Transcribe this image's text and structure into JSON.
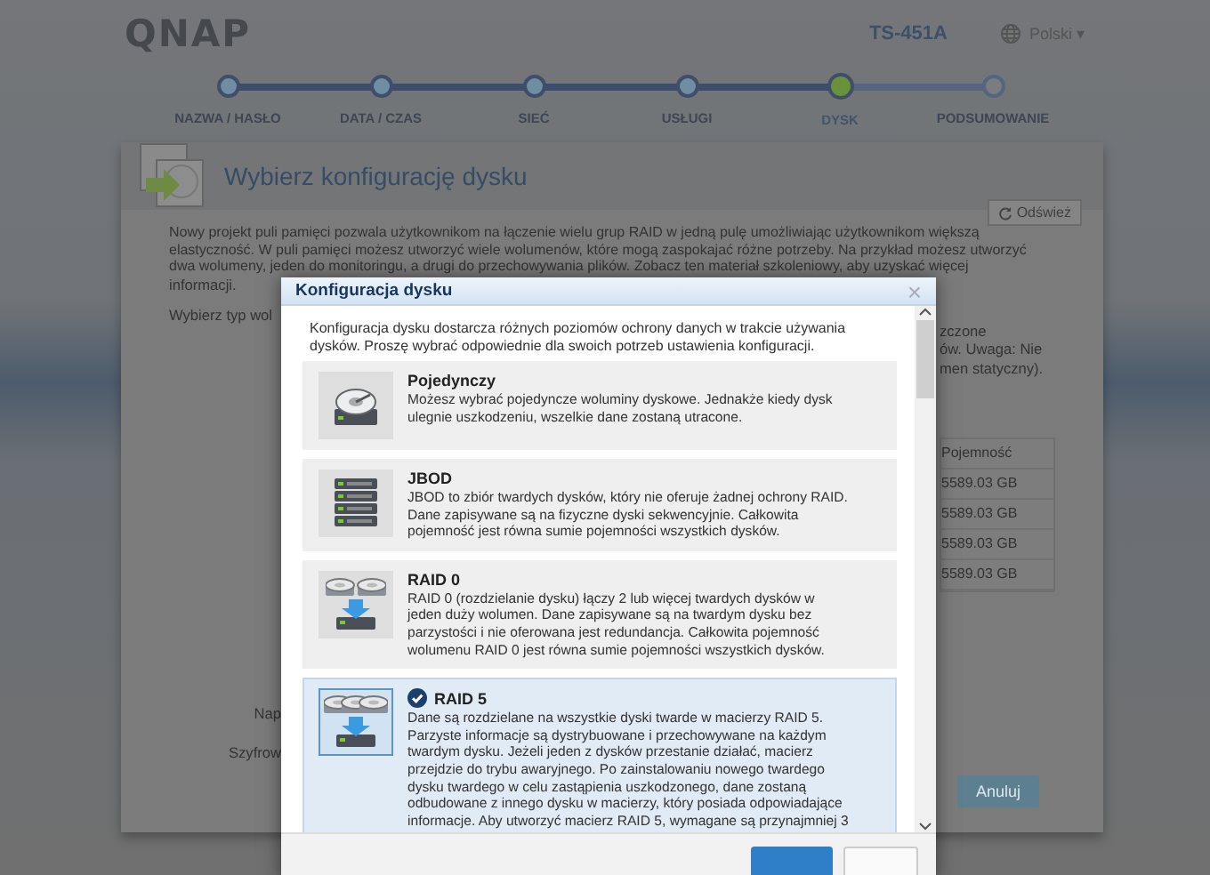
{
  "header": {
    "logo": "QNAP",
    "model": "TS-451A",
    "language": "Polski",
    "language_caret": "▾"
  },
  "steps": [
    {
      "label": "NAZWA / HASŁO",
      "completed": true,
      "selected": false
    },
    {
      "label": "DATA / CZAS",
      "completed": true,
      "selected": false
    },
    {
      "label": "SIEĆ",
      "completed": true,
      "selected": false
    },
    {
      "label": "USŁUGI",
      "completed": true,
      "selected": false
    },
    {
      "label": "DYSK",
      "completed": false,
      "selected": true
    },
    {
      "label": "PODSUMOWANIE",
      "completed": false,
      "selected": false
    }
  ],
  "page": {
    "title": "Wybierz konfigurację dysku",
    "refresh_button": "Odśwież",
    "intro_lines": [
      "Nowy projekt puli pamięci pozwala użytkownikom na łączenie wielu grup RAID w jedną pulę umożliwiając użytkownikom większą",
      "elastyczność. W puli pamięci możesz utworzyć wiele wolumenów, które mogą zaspokajać różne potrzeby. Na przykład możesz utworzyć",
      "dwa wolumeny, jeden do monitoringu, a drugi do przechowywania plików. Zobacz ten materiał szkoleniowy, aby uzyskać więcej"
    ],
    "intro_tail": "informacji.",
    "left_fragment": "Wybierz typ wol",
    "right_fragments": [
      "zczone",
      "ów. Uwaga: Nie",
      "men statyczny)."
    ],
    "table": {
      "column": "Pojemność",
      "rows": [
        "5589.03 GB",
        "5589.03 GB",
        "5589.03 GB",
        "5589.03 GB"
      ]
    },
    "form_labels": [
      "Nap",
      "Szyfrow"
    ],
    "cancel_button": "Anuluj"
  },
  "dialog": {
    "title": "Konfiguracja dysku",
    "close": "×",
    "intro_lines": [
      "Konfiguracja dysku dostarcza różnych poziomów ochrony danych w trakcie używania",
      "dysków. Proszę wybrać odpowiednie dla swoich potrzeb ustawienia konfiguracji."
    ],
    "options": [
      {
        "kind": "single",
        "name": "Pojedynczy",
        "selected": false,
        "lines": [
          "Możesz wybrać pojedyncze woluminy dyskowe. Jednakże kiedy dysk",
          "ulegnie uszkodzeniu, wszelkie dane zostaną utracone."
        ]
      },
      {
        "kind": "jbod",
        "name": "JBOD",
        "selected": false,
        "lines": [
          "JBOD to zbiór twardych dysków, który nie oferuje żadnej ochrony RAID.",
          "Dane zapisywane są na fizyczne dyski sekwencyjnie. Całkowita",
          "pojemność jest równa sumie pojemności wszystkich dysków."
        ]
      },
      {
        "kind": "raid0",
        "name": "RAID 0",
        "selected": false,
        "lines": [
          "RAID 0 (rozdzielanie dysku) łączy 2 lub więcej twardych dysków w",
          "jeden duży wolumen. Dane zapisywane są na twardym dysku bez",
          "parzystości i nie oferowana jest redundancja. Całkowita pojemność",
          "wolumenu RAID 0 jest równa sumie pojemności wszystkich dysków."
        ]
      },
      {
        "kind": "raid5",
        "name": "RAID 5",
        "selected": true,
        "lines": [
          "Dane są rozdzielane na wszystkie dyski twarde w macierzy RAID 5.",
          "Parzyste informacje są dystrybuowane i przechowywane na każdym",
          "twardym dysku. Jeżeli jeden z dysków przestanie działać, macierz",
          "przejdzie do trybu awaryjnego. Po zainstalowaniu nowego twardego",
          "dysku twardego w celu zastąpienia uszkodzonego, dane zostaną",
          "odbudowane z innego dysku w macierzy, który posiada odpowiadające",
          "informacje. Aby utworzyć macierz RAID 5, wymagane są przynajmniej 3"
        ]
      }
    ]
  }
}
